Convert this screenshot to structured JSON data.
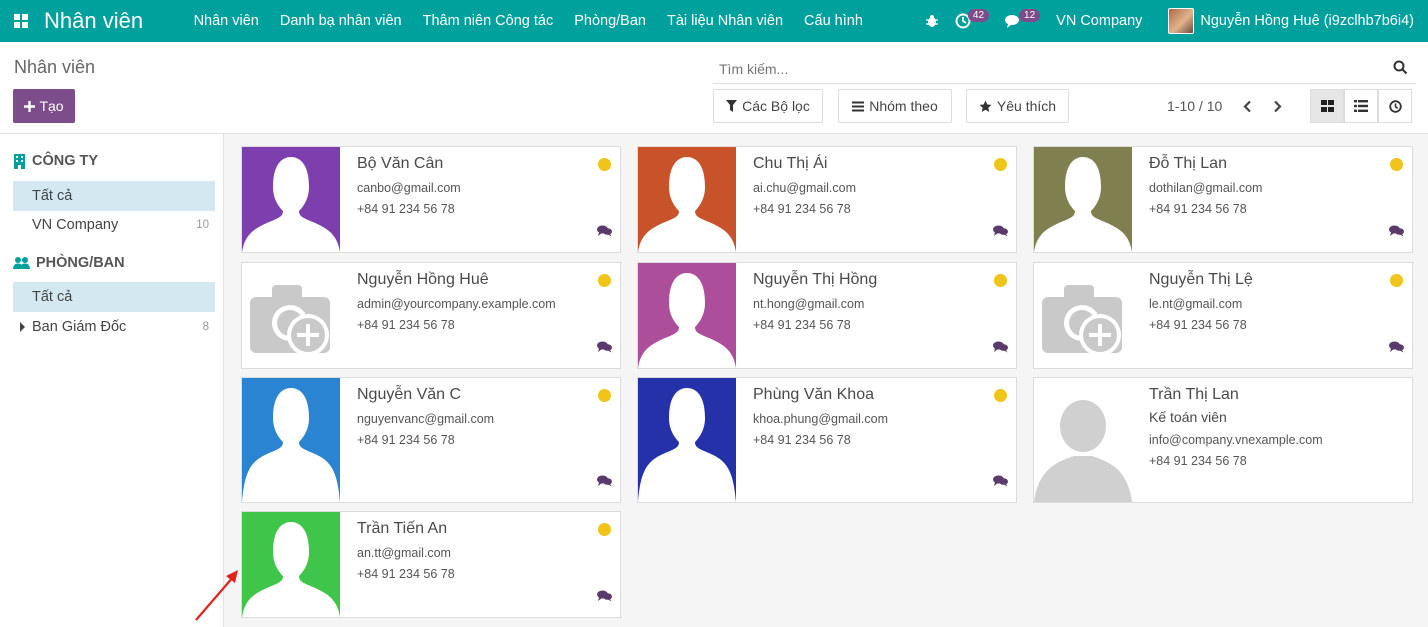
{
  "navbar": {
    "brand": "Nhân viên",
    "menu": [
      "Nhân viên",
      "Danh bạ nhân viên",
      "Thâm niên Công tác",
      "Phòng/Ban",
      "Tài liệu Nhân viên",
      "Cấu hình"
    ],
    "activities_count": "42",
    "messages_count": "12",
    "company": "VN Company",
    "user": "Nguyễn Hồng Huê (i9zclhb7b6i4)"
  },
  "control": {
    "breadcrumb": "Nhân viên",
    "create_label": "Tạo",
    "search_placeholder": "Tìm kiếm...",
    "filters_label": "Các Bộ lọc",
    "group_label": "Nhóm theo",
    "favorites_label": "Yêu thích",
    "pager": "1-10 / 10"
  },
  "sidebar": {
    "company_title": "CÔNG TY",
    "company_items": [
      {
        "label": "Tất cả",
        "count": ""
      },
      {
        "label": "VN Company",
        "count": "10"
      }
    ],
    "dept_title": "PHÒNG/BAN",
    "dept_items": [
      {
        "label": "Tất cả",
        "count": ""
      },
      {
        "label": "Ban Giám Đốc",
        "count": "8"
      }
    ]
  },
  "employees": [
    {
      "name": "Bộ Văn Cân",
      "job": "",
      "email": "canbo@gmail.com",
      "phone": "+84 91 234 56 78",
      "avatar": "silhouette",
      "color": "#7e3fae",
      "status": true,
      "chat": true
    },
    {
      "name": "Chu Thị Ái",
      "job": "",
      "email": "ai.chu@gmail.com",
      "phone": "+84 91 234 56 78",
      "avatar": "silhouette",
      "color": "#c8522a",
      "status": true,
      "chat": true
    },
    {
      "name": "Đỗ Thị Lan",
      "job": "",
      "email": "dothilan@gmail.com",
      "phone": "+84 91 234 56 78",
      "avatar": "silhouette",
      "color": "#7f7f50",
      "status": true,
      "chat": true
    },
    {
      "name": "Nguyễn Hồng Huê",
      "job": "",
      "email": "admin@yourcompany.example.com",
      "phone": "+84 91 234 56 78",
      "avatar": "camera",
      "color": "#ffffff",
      "status": true,
      "chat": true
    },
    {
      "name": "Nguyễn Thị Hồng",
      "job": "",
      "email": "nt.hong@gmail.com",
      "phone": "+84 91 234 56 78",
      "avatar": "silhouette",
      "color": "#ad4e9a",
      "status": true,
      "chat": true
    },
    {
      "name": "Nguyễn Thị Lệ",
      "job": "",
      "email": "le.nt@gmail.com",
      "phone": "+84 91 234 56 78",
      "avatar": "camera",
      "color": "#ffffff",
      "status": true,
      "chat": true
    },
    {
      "name": "Nguyễn Văn C",
      "job": "",
      "email": "nguyenvanc@gmail.com",
      "phone": "+84 91 234 56 78",
      "avatar": "silhouette",
      "color": "#2a84d2",
      "status": true,
      "chat": true
    },
    {
      "name": "Phùng Văn Khoa",
      "job": "",
      "email": "khoa.phung@gmail.com",
      "phone": "+84 91 234 56 78",
      "avatar": "silhouette",
      "color": "#2431a8",
      "status": true,
      "chat": true
    },
    {
      "name": "Trần Thị Lan",
      "job": "Kế toán viên",
      "email": "info@company.vnexample.com",
      "phone": "+84 91 234 56 78",
      "avatar": "gray-person",
      "color": "#ffffff",
      "status": false,
      "chat": false
    },
    {
      "name": "Trần Tiến An",
      "job": "",
      "email": "an.tt@gmail.com",
      "phone": "+84 91 234 56 78",
      "avatar": "silhouette",
      "color": "#3fc54a",
      "status": true,
      "chat": true
    }
  ]
}
